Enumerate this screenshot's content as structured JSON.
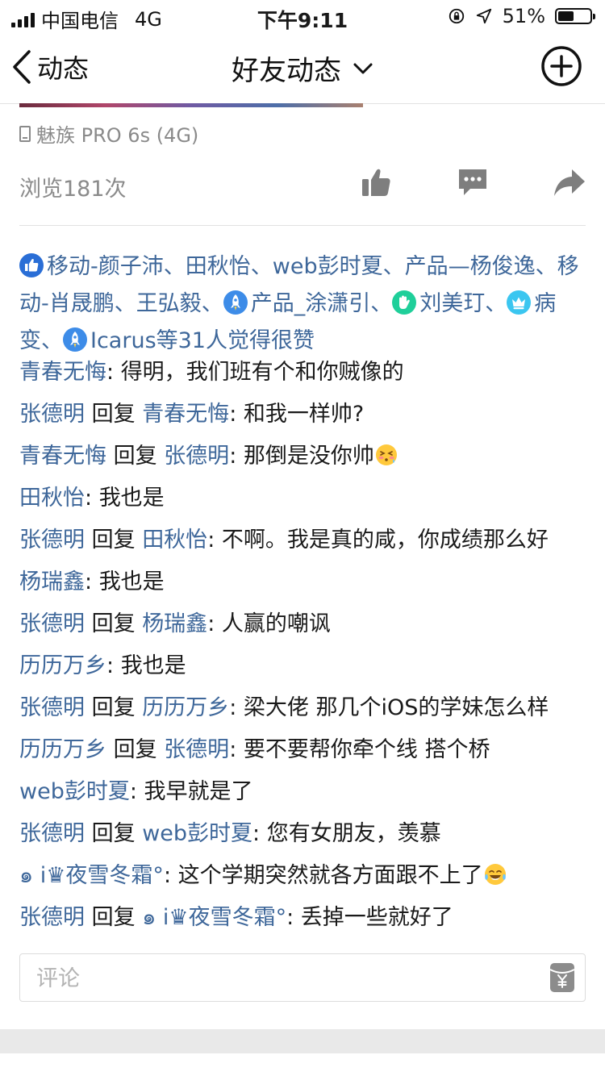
{
  "status_bar": {
    "carrier": "中国电信",
    "network": "4G",
    "time": "下午9:11",
    "battery_percent": "51%",
    "battery_level": 0.51
  },
  "nav": {
    "back_label": "动态",
    "title": "好友动态"
  },
  "post": {
    "device": "魅族 PRO 6s (4G)",
    "views": "浏览181次"
  },
  "likes": {
    "names": [
      {
        "badge": "thumb",
        "text": "移动-颜子沛、"
      },
      {
        "badge": null,
        "text": "田秋怡、"
      },
      {
        "badge": null,
        "text": "web彭时夏、"
      },
      {
        "badge": null,
        "text": "产品—杨俊逸、"
      },
      {
        "badge": null,
        "text": "移动-肖晟鹏、"
      },
      {
        "badge": null,
        "text": "王弘毅、"
      },
      {
        "badge": "rocket",
        "text": "产品_涂潇引、"
      },
      {
        "badge": "hand",
        "text": "刘美玎、"
      },
      {
        "badge": "crown",
        "text": "病变、"
      },
      {
        "badge": "rocket",
        "text": "Icarus等31人觉得很赞"
      }
    ]
  },
  "comments": [
    {
      "user": "青春无悔",
      "reply_to": null,
      "text": "得明，我们班有个和你贼像的",
      "emoji": null
    },
    {
      "user": "张德明",
      "reply_to": "青春无悔",
      "text": "和我一样帅?",
      "emoji": null
    },
    {
      "user": "青春无悔",
      "reply_to": "张德明",
      "text": "那倒是没你帅",
      "emoji": "shy-face"
    },
    {
      "user": "田秋怡",
      "reply_to": null,
      "text": "我也是",
      "emoji": null
    },
    {
      "user": "张德明",
      "reply_to": "田秋怡",
      "text": "不啊。我是真的咸，你成绩那么好",
      "emoji": null
    },
    {
      "user": "杨瑞鑫",
      "reply_to": null,
      "text": "我也是",
      "emoji": null
    },
    {
      "user": "张德明",
      "reply_to": "杨瑞鑫",
      "text": "人赢的嘲讽",
      "emoji": null
    },
    {
      "user": "历历万乡",
      "reply_to": null,
      "text": "我也是",
      "emoji": null
    },
    {
      "user": "张德明",
      "reply_to": "历历万乡",
      "text": "梁大佬 那几个iOS的学妹怎么样",
      "emoji": null
    },
    {
      "user": "历历万乡",
      "reply_to": "张德明",
      "text": "要不要帮你牵个线 搭个桥",
      "emoji": null
    },
    {
      "user": "web彭时夏",
      "reply_to": null,
      "text": "我早就是了",
      "emoji": null
    },
    {
      "user": "张德明",
      "reply_to": "web彭时夏",
      "text": "您有女朋友，羡慕",
      "emoji": null
    },
    {
      "user": "๑ i♛夜雪冬霜°",
      "reply_to": null,
      "text": "这个学期突然就各方面跟不上了",
      "emoji": "tears-of-joy"
    },
    {
      "user": "张德明",
      "reply_to": "๑ i♛夜雪冬霜°",
      "text": "丢掉一些就好了",
      "emoji": null
    }
  ],
  "reply_word": "回复",
  "comment_input": {
    "placeholder": "评论"
  },
  "colors": {
    "link_blue": "#3e679a",
    "icon_gray": "#7e7e7e",
    "badge_blue": "#2a6ed6",
    "badge_green": "#1fcf9a",
    "badge_cyan": "#3bc6f0"
  }
}
